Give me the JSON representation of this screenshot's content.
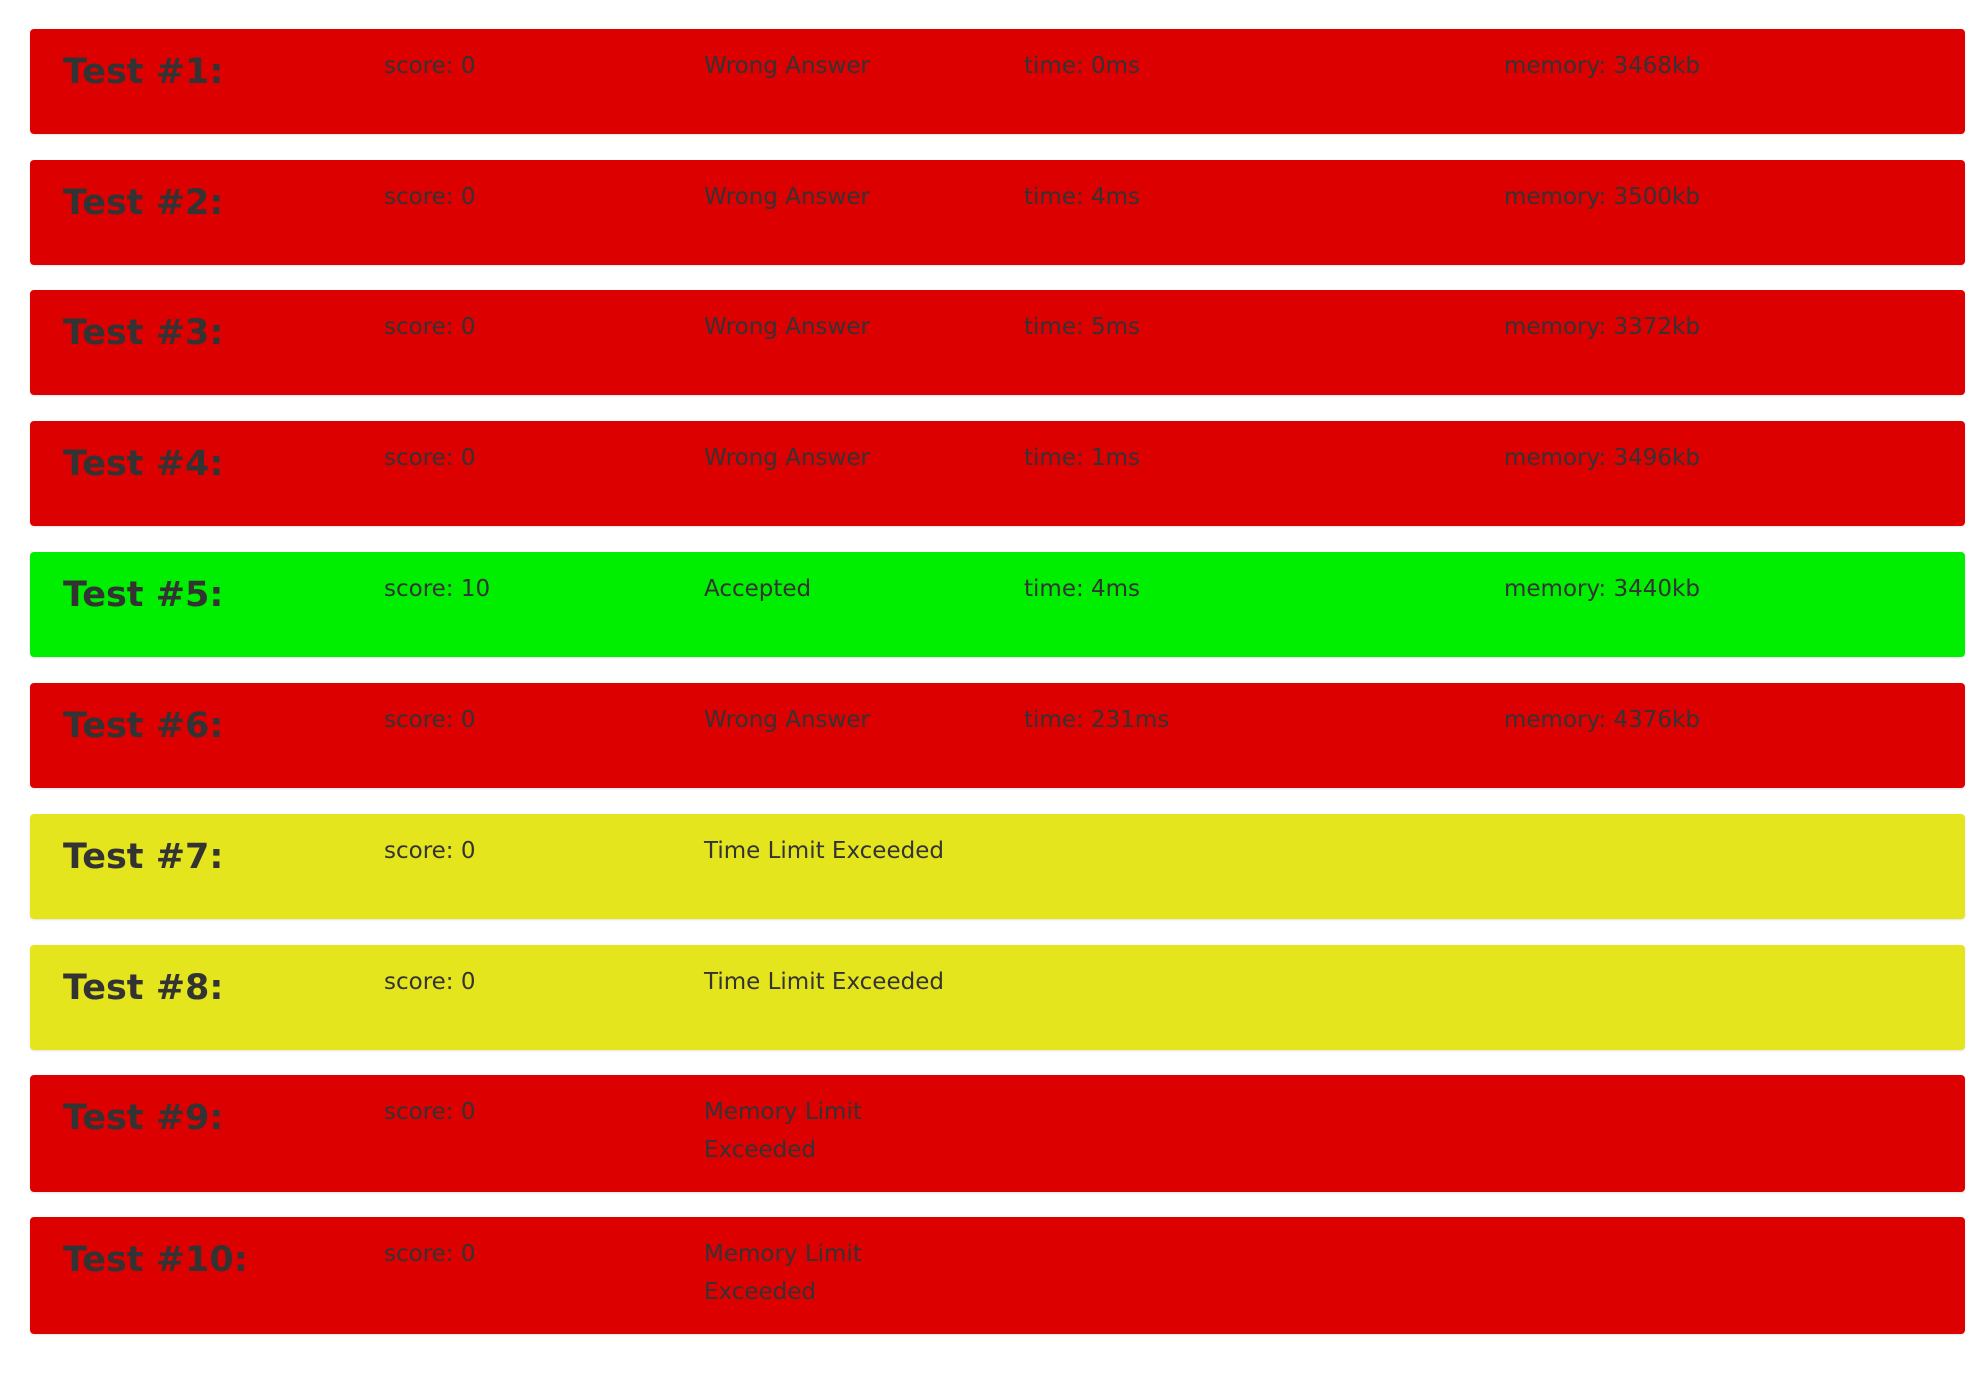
{
  "colors": {
    "wrong": "#dd0000",
    "accepted": "#00ee00",
    "timelimit": "#e5e51e",
    "text": "#333333"
  },
  "tests": [
    {
      "title": "Test #1:",
      "score": "score: 0",
      "status": "Wrong Answer",
      "time": "time: 0ms",
      "memory": "memory: 3468kb",
      "color": "red"
    },
    {
      "title": "Test #2:",
      "score": "score: 0",
      "status": "Wrong Answer",
      "time": "time: 4ms",
      "memory": "memory: 3500kb",
      "color": "red"
    },
    {
      "title": "Test #3:",
      "score": "score: 0",
      "status": "Wrong Answer",
      "time": "time: 5ms",
      "memory": "memory: 3372kb",
      "color": "red"
    },
    {
      "title": "Test #4:",
      "score": "score: 0",
      "status": "Wrong Answer",
      "time": "time: 1ms",
      "memory": "memory: 3496kb",
      "color": "red"
    },
    {
      "title": "Test #5:",
      "score": "score: 10",
      "status": "Accepted",
      "time": "time: 4ms",
      "memory": "memory: 3440kb",
      "color": "green"
    },
    {
      "title": "Test #6:",
      "score": "score: 0",
      "status": "Wrong Answer",
      "time": "time: 231ms",
      "memory": "memory: 4376kb",
      "color": "red"
    },
    {
      "title": "Test #7:",
      "score": "score: 0",
      "status": "Time Limit Exceeded",
      "color": "yellow"
    },
    {
      "title": "Test #8:",
      "score": "score: 0",
      "status": "Time Limit Exceeded",
      "color": "yellow"
    },
    {
      "title": "Test #9:",
      "score": "score: 0",
      "status": "Memory Limit Exceeded",
      "color": "red"
    },
    {
      "title": "Test #10:",
      "score": "score: 0",
      "status": "Memory Limit Exceeded",
      "color": "red"
    }
  ]
}
